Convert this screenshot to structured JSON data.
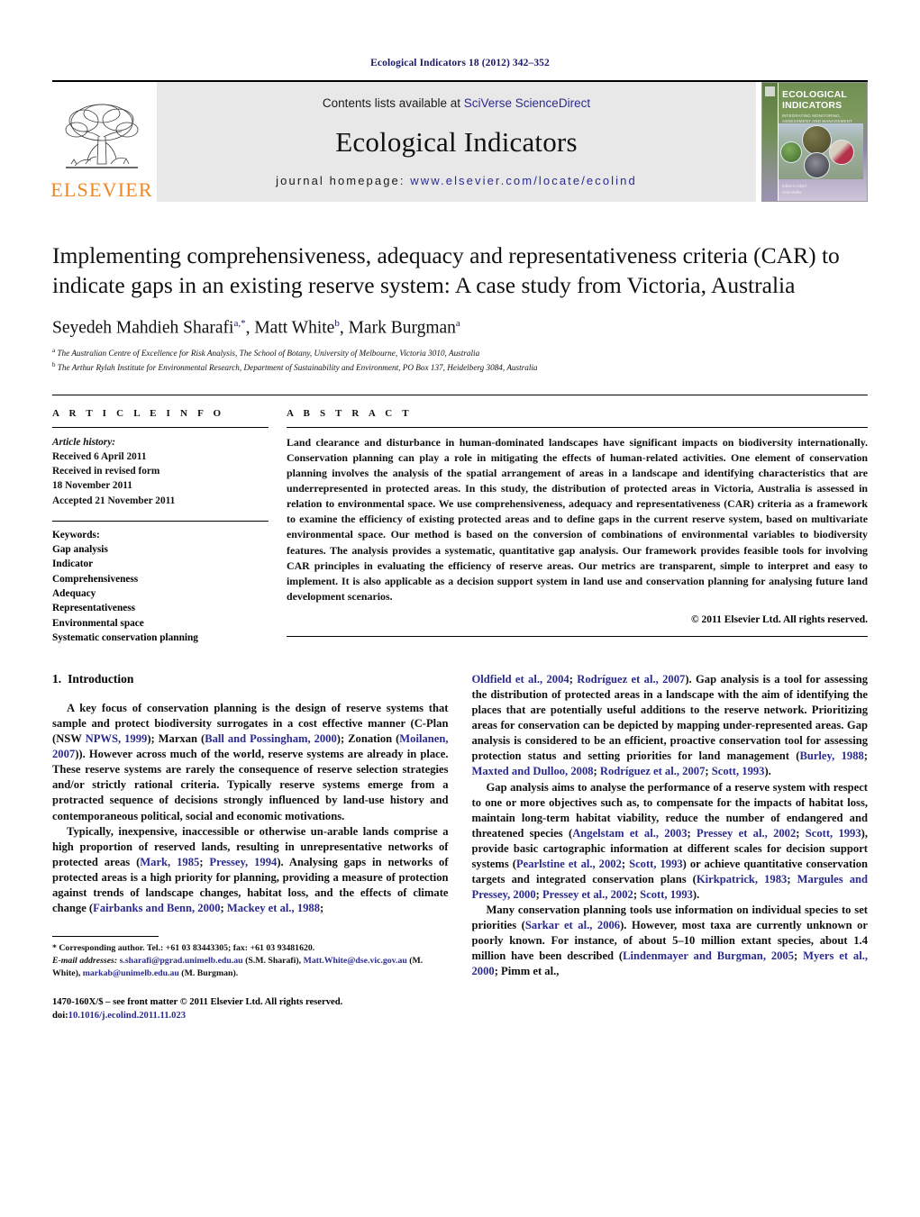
{
  "running_head": "Ecological Indicators 18 (2012) 342–352",
  "masthead": {
    "publisher_word": "ELSEVIER",
    "contents_prefix": "Contents lists available at ",
    "contents_link": "SciVerse ScienceDirect",
    "journal_title": "Ecological Indicators",
    "homepage_prefix": "journal homepage: ",
    "homepage_url": "www.elsevier.com/locate/ecolind",
    "cover": {
      "title_line1": "ECOLOGICAL",
      "title_line2": "INDICATORS",
      "subtitle": "INTEGRATING MONITORING, ASSESSMENT AND MANAGEMENT",
      "footer_line1": "Editor-in-Chief",
      "footer_line2": "Felix Müller"
    }
  },
  "article": {
    "title": "Implementing comprehensiveness, adequacy and representativeness criteria (CAR) to indicate gaps in an existing reserve system: A case study from Victoria, Australia",
    "authors": [
      {
        "name": "Seyedeh Mahdieh Sharafi",
        "marks": "a,*"
      },
      {
        "name": "Matt White",
        "marks": "b"
      },
      {
        "name": "Mark Burgman",
        "marks": "a"
      }
    ],
    "affiliations": [
      {
        "mark": "a",
        "text": "The Australian Centre of Excellence for Risk Analysis, The School of Botany, University of Melbourne, Victoria 3010, Australia"
      },
      {
        "mark": "b",
        "text": "The Arthur Rylah Institute for Environmental Research, Department of Sustainability and Environment, PO Box 137, Heidelberg 3084, Australia"
      }
    ]
  },
  "article_info": {
    "heading": "A R T I C L E    I N F O",
    "history_label": "Article history:",
    "history": [
      "Received 6 April 2011",
      "Received in revised form",
      "18 November 2011",
      "Accepted 21 November 2011"
    ],
    "keywords_label": "Keywords:",
    "keywords": [
      "Gap analysis",
      "Indicator",
      "Comprehensiveness",
      "Adequacy",
      "Representativeness",
      "Environmental space",
      "Systematic conservation planning"
    ]
  },
  "abstract": {
    "heading": "A B S T R A C T",
    "text": "Land clearance and disturbance in human-dominated landscapes have significant impacts on biodiversity internationally. Conservation planning can play a role in mitigating the effects of human-related activities. One element of conservation planning involves the analysis of the spatial arrangement of areas in a landscape and identifying characteristics that are underrepresented in protected areas. In this study, the distribution of protected areas in Victoria, Australia is assessed in relation to environmental space. We use comprehensiveness, adequacy and representativeness (CAR) criteria as a framework to examine the efficiency of existing protected areas and to define gaps in the current reserve system, based on multivariate environmental space. Our method is based on the conversion of combinations of environmental variables to biodiversity features. The analysis provides a systematic, quantitative gap analysis. Our framework provides feasible tools for involving CAR principles in evaluating the efficiency of reserve areas. Our metrics are transparent, simple to interpret and easy to implement. It is also applicable as a decision support system in land use and conservation planning for analysing future land development scenarios.",
    "copyright": "© 2011 Elsevier Ltd. All rights reserved."
  },
  "introduction": {
    "number": "1.",
    "heading": "Introduction",
    "left_paragraphs": [
      "A key focus of conservation planning is the design of reserve systems that sample and protect biodiversity surrogates in a cost effective manner (C-Plan (NSW NPWS, 1999); Marxan (Ball and Possingham, 2000); Zonation (Moilanen, 2007)). However across much of the world, reserve systems are already in place. These reserve systems are rarely the consequence of reserve selection strategies and/or strictly rational criteria. Typically reserve systems emerge from a protracted sequence of decisions strongly influenced by land-use history and contemporaneous political, social and economic motivations.",
      "Typically, inexpensive, inaccessible or otherwise un-arable lands comprise a high proportion of reserved lands, resulting in unrepresentative networks of protected areas (Mark, 1985; Pressey, 1994). Analysing gaps in networks of protected areas is a high priority for planning, providing a measure of protection against trends of landscape changes, habitat loss, and the effects of climate change (Fairbanks and Benn, 2000; Mackey et al., 1988;"
    ],
    "right_paragraphs": [
      "Oldfield et al., 2004; Rodríguez et al., 2007). Gap analysis is a tool for assessing the distribution of protected areas in a landscape with the aim of identifying the places that are potentially useful additions to the reserve network. Prioritizing areas for conservation can be depicted by mapping under-represented areas. Gap analysis is considered to be an efficient, proactive conservation tool for assessing protection status and setting priorities for land management (Burley, 1988; Maxted and Dulloo, 2008; Rodríguez et al., 2007; Scott, 1993).",
      "Gap analysis aims to analyse the performance of a reserve system with respect to one or more objectives such as, to compensate for the impacts of habitat loss, maintain long-term habitat viability, reduce the number of endangered and threatened species (Angelstam et al., 2003; Pressey et al., 2002; Scott, 1993), provide basic cartographic information at different scales for decision support systems (Pearlstine et al., 2002; Scott, 1993) or achieve quantitative conservation targets and integrated conservation plans (Kirkpatrick, 1983; Margules and Pressey, 2000; Pressey et al., 2002; Scott, 1993).",
      "Many conservation planning tools use information on individual species to set priorities (Sarkar et al., 2006). However, most taxa are currently unknown or poorly known. For instance, of about 5–10 million extant species, about 1.4 million have been described (Lindenmayer and Burgman, 2005; Myers et al., 2000; Pimm et al.,"
    ]
  },
  "footnotes": {
    "corresponding": "* Corresponding author. Tel.: +61 03 83443305; fax: +61 03 93481620.",
    "email_label": "E-mail addresses:",
    "email_1": "s.sharafi@pgrad.unimelb.edu.au",
    "email_1_name": " (S.M. Sharafi),",
    "email_2": "Matt.White@dse.vic.gov.au",
    "email_2_name": " (M. White), ",
    "email_3": "markab@unimelb.edu.au",
    "email_3_name": " (M. Burgman)."
  },
  "imprint": {
    "line1": "1470-160X/$ – see front matter © 2011 Elsevier Ltd. All rights reserved.",
    "doi_label": "doi:",
    "doi_value": "10.1016/j.ecolind.2011.11.023"
  }
}
